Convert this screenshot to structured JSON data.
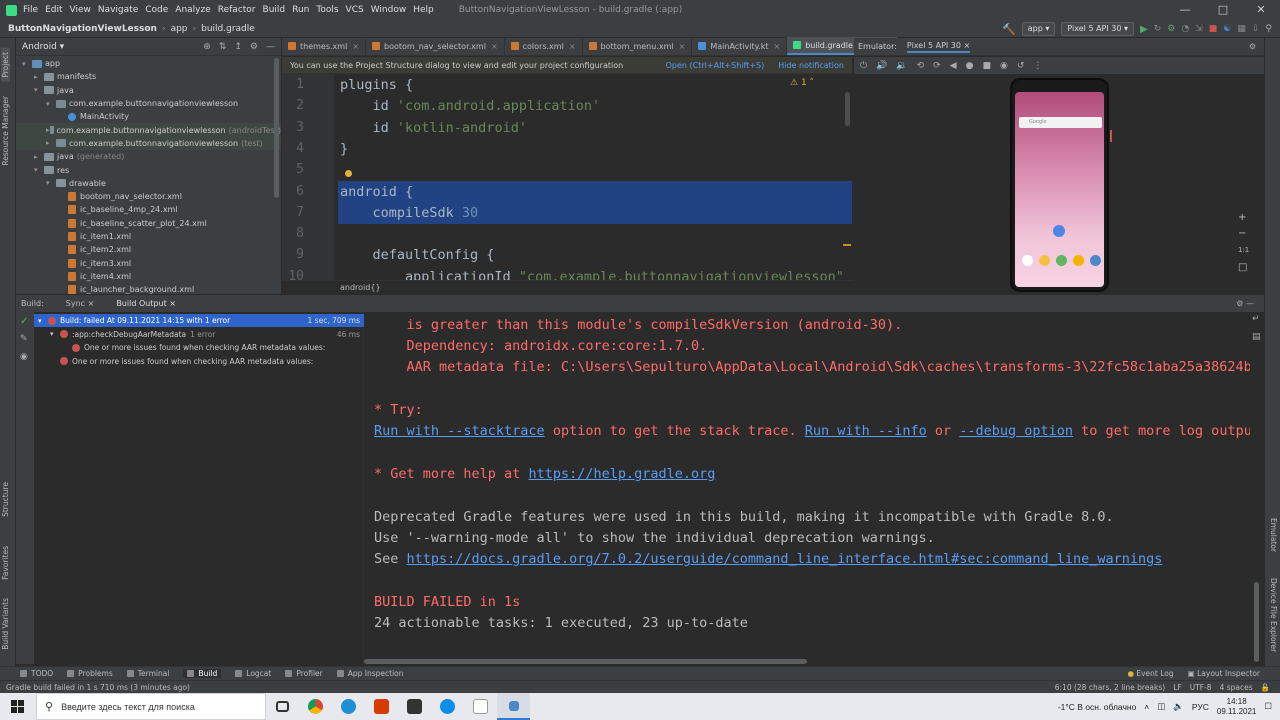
{
  "menu": {
    "items": [
      "File",
      "Edit",
      "View",
      "Navigate",
      "Code",
      "Analyze",
      "Refactor",
      "Build",
      "Run",
      "Tools",
      "VCS",
      "Window",
      "Help"
    ],
    "window_title": "ButtonNavigationViewLesson - build.gradle (:app)"
  },
  "navbar": {
    "project": "ButtonNavigationViewLesson",
    "module": "app",
    "file": "build.gradle",
    "run_config": "app",
    "device": "Pixel 5 API 30"
  },
  "project_panel": {
    "view_mode": "Android",
    "items": [
      {
        "label": "app",
        "indent": 0,
        "kind": "folder-blue",
        "expanded": true
      },
      {
        "label": "manifests",
        "indent": 1,
        "kind": "folder",
        "expanded": false
      },
      {
        "label": "java",
        "indent": 1,
        "kind": "folder",
        "expanded": true
      },
      {
        "label": "com.example.buttonnavigationviewlesson",
        "indent": 2,
        "kind": "pkg",
        "expanded": true
      },
      {
        "label": "MainActivity",
        "indent": 3,
        "kind": "kt"
      },
      {
        "label": "com.example.buttonnavigationviewlesson",
        "suffix": "(androidTest)",
        "indent": 2,
        "kind": "pkg",
        "expanded": false,
        "hl": true
      },
      {
        "label": "com.example.buttonnavigationviewlesson",
        "suffix": "(test)",
        "indent": 2,
        "kind": "pkg",
        "expanded": false,
        "hl": true
      },
      {
        "label": "java",
        "suffix": "(generated)",
        "indent": 1,
        "kind": "folder",
        "expanded": false
      },
      {
        "label": "res",
        "indent": 1,
        "kind": "folder",
        "expanded": true
      },
      {
        "label": "drawable",
        "indent": 2,
        "kind": "folder",
        "expanded": true
      },
      {
        "label": "bootom_nav_selector.xml",
        "indent": 3,
        "kind": "file"
      },
      {
        "label": "ic_baseline_4mp_24.xml",
        "indent": 3,
        "kind": "file"
      },
      {
        "label": "ic_baseline_scatter_plot_24.xml",
        "indent": 3,
        "kind": "file"
      },
      {
        "label": "ic_item1.xml",
        "indent": 3,
        "kind": "file"
      },
      {
        "label": "ic_item2.xml",
        "indent": 3,
        "kind": "file"
      },
      {
        "label": "ic_item3.xml",
        "indent": 3,
        "kind": "file"
      },
      {
        "label": "ic_item4.xml",
        "indent": 3,
        "kind": "file"
      },
      {
        "label": "ic_launcher_background.xml",
        "indent": 3,
        "kind": "file"
      }
    ]
  },
  "editor_tabs": [
    {
      "label": "themes.xml",
      "color": "#cc7832",
      "active": false
    },
    {
      "label": "bootom_nav_selector.xml",
      "color": "#cc7832",
      "active": false
    },
    {
      "label": "colors.xml",
      "color": "#cc7832",
      "active": false
    },
    {
      "label": "bottom_menu.xml",
      "color": "#cc7832",
      "active": false
    },
    {
      "label": "MainActivity.kt",
      "color": "#4a8fd8",
      "active": false
    },
    {
      "label": "build.gradle (:app)",
      "color": "#3ddc84",
      "active": true
    }
  ],
  "notification": {
    "text": "You can use the Project Structure dialog to view and edit your project configuration",
    "open_link": "Open (Ctrl+Alt+Shift+S)",
    "hide_link": "Hide notification"
  },
  "editor": {
    "warning_count": "1",
    "line_numbers": [
      "1",
      "2",
      "3",
      "4",
      "5",
      "6",
      "7",
      "8",
      "9",
      "10"
    ],
    "lines": [
      {
        "code": "plugins {"
      },
      {
        "code": "    id 'com.android.application'"
      },
      {
        "code": "    id 'kotlin-android'"
      },
      {
        "code": "}"
      },
      {
        "code": ""
      },
      {
        "code": "android {",
        "selected": true
      },
      {
        "code": "    compileSdk 30",
        "selected": true
      },
      {
        "code": ""
      },
      {
        "code": "    defaultConfig {"
      },
      {
        "code": "        applicationId \"com.example.buttonnavigationviewlesson\""
      }
    ],
    "breadcrumb": "android{}"
  },
  "emulator": {
    "tab_label": "Emulator:",
    "device_tab": "Pixel 5 API 30",
    "search_placeholder": "Google",
    "zoom_label": "1:1"
  },
  "build_window": {
    "tabs": [
      "Build:",
      "Sync",
      "Build Output"
    ],
    "tree": [
      {
        "label": "Build: failed At 09.11.2021 14:15 with 1 error",
        "time": "1 sec, 709 ms",
        "indent": 0,
        "selected": true
      },
      {
        "label": ":app:checkDebugAarMetadata",
        "suffix": "1 error",
        "time": "46 ms",
        "indent": 1
      },
      {
        "label": "One or more issues found when checking AAR metadata values:",
        "indent": 2
      },
      {
        "label": "One or more issues found when checking AAR metadata values:",
        "indent": 1
      }
    ],
    "console": {
      "line1": "    is greater than this module's compileSdkVersion (android-30).",
      "line2": "    Dependency: androidx.core:core:1.7.0.",
      "line3": "    AAR metadata file: C:\\Users\\Sepulturo\\AppData\\Local\\Android\\Sdk\\caches\\transforms-3\\22fc58c1aba25a38624b",
      "try": "* Try:",
      "try_link1": "Run with --stacktrace",
      "try_text1": " option to get the stack trace. ",
      "try_link2": "Run with --info",
      "try_text2": " or ",
      "try_link3": "--debug option",
      "try_text3": " to get more log output",
      "help_prefix": "* Get more help at ",
      "help_link": "https://help.gradle.org",
      "deprecated1": "Deprecated Gradle features were used in this build, making it incompatible with Gradle 8.0.",
      "deprecated2": "Use '--warning-mode all' to show the individual deprecation warnings.",
      "see_prefix": "See ",
      "see_link": "https://docs.gradle.org/7.0.2/userguide/command_line_interface.html#sec:command_line_warnings",
      "failed": "BUILD FAILED in 1s",
      "tasks": "24 actionable tasks: 1 executed, 23 up-to-date"
    }
  },
  "bottom_tools": {
    "left": [
      "TODO",
      "Problems",
      "Terminal",
      "Build",
      "Logcat",
      "Profiler",
      "App Inspection"
    ],
    "right": [
      "Event Log",
      "Layout Inspector"
    ]
  },
  "statusbar": {
    "message": "Gradle build failed in 1 s 710 ms (3 minutes ago)",
    "position": "6:10 (28 chars, 2 line breaks)",
    "line_sep": "LF",
    "encoding": "UTF-8",
    "indent": "4 spaces"
  },
  "side_labels": {
    "project": "Project",
    "resource_manager": "Resource Manager",
    "structure": "Structure",
    "favorites": "Favorites",
    "build_variants": "Build Variants",
    "emulator": "Emulator",
    "device_file_explorer": "Device File Explorer"
  },
  "taskbar": {
    "search_placeholder": "Введите здесь текст для поиска",
    "weather": "-1°C  В осн. облачно",
    "lang": "РУС",
    "time": "14:18",
    "date": "09.11.2021"
  },
  "colors": {
    "accent": "#4a88c7",
    "error": "#ff6b68",
    "link": "#589df6",
    "selection": "#214283"
  }
}
